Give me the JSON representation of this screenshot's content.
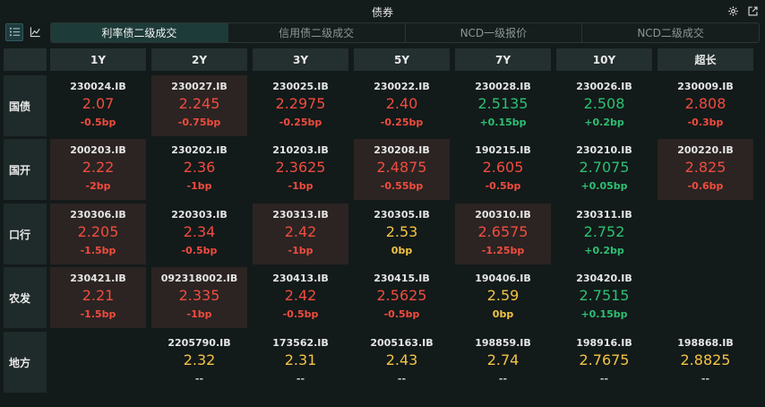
{
  "window": {
    "title": "债券"
  },
  "view_buttons": [
    {
      "name": "list-view-button",
      "icon": "list-icon",
      "active": true
    },
    {
      "name": "chart-view-button",
      "icon": "line-chart-icon",
      "active": false
    }
  ],
  "tabs": [
    {
      "label": "利率债二级成交",
      "active": true
    },
    {
      "label": "信用债二级成交",
      "active": false
    },
    {
      "label": "NCD一级报价",
      "active": false
    },
    {
      "label": "NCD二级成交",
      "active": false
    }
  ],
  "columns": [
    "1Y",
    "2Y",
    "3Y",
    "5Y",
    "7Y",
    "10Y",
    "超长"
  ],
  "rows": [
    {
      "label": "国债",
      "cells": [
        {
          "code": "230024.IB",
          "rate": "2.07",
          "change": "-0.5bp",
          "dir": "down",
          "hl": false
        },
        {
          "code": "230027.IB",
          "rate": "2.245",
          "change": "-0.75bp",
          "dir": "down",
          "hl": true
        },
        {
          "code": "230025.IB",
          "rate": "2.2975",
          "change": "-0.25bp",
          "dir": "down",
          "hl": false
        },
        {
          "code": "230022.IB",
          "rate": "2.40",
          "change": "-0.25bp",
          "dir": "down",
          "hl": false
        },
        {
          "code": "230028.IB",
          "rate": "2.5135",
          "change": "+0.15bp",
          "dir": "up",
          "hl": false
        },
        {
          "code": "230026.IB",
          "rate": "2.508",
          "change": "+0.2bp",
          "dir": "up",
          "hl": false
        },
        {
          "code": "230009.IB",
          "rate": "2.808",
          "change": "-0.3bp",
          "dir": "down",
          "hl": false
        }
      ]
    },
    {
      "label": "国开",
      "cells": [
        {
          "code": "200203.IB",
          "rate": "2.22",
          "change": "-2bp",
          "dir": "down",
          "hl": true
        },
        {
          "code": "230202.IB",
          "rate": "2.36",
          "change": "-1bp",
          "dir": "down",
          "hl": false
        },
        {
          "code": "210203.IB",
          "rate": "2.3625",
          "change": "-1bp",
          "dir": "down",
          "hl": false
        },
        {
          "code": "230208.IB",
          "rate": "2.4875",
          "change": "-0.55bp",
          "dir": "down",
          "hl": true
        },
        {
          "code": "190215.IB",
          "rate": "2.605",
          "change": "-0.5bp",
          "dir": "down",
          "hl": false
        },
        {
          "code": "230210.IB",
          "rate": "2.7075",
          "change": "+0.05bp",
          "dir": "up",
          "hl": false
        },
        {
          "code": "200220.IB",
          "rate": "2.825",
          "change": "-0.6bp",
          "dir": "down",
          "hl": true
        }
      ]
    },
    {
      "label": "口行",
      "cells": [
        {
          "code": "230306.IB",
          "rate": "2.205",
          "change": "-1.5bp",
          "dir": "down",
          "hl": true
        },
        {
          "code": "220303.IB",
          "rate": "2.34",
          "change": "-0.5bp",
          "dir": "down",
          "hl": false
        },
        {
          "code": "230313.IB",
          "rate": "2.42",
          "change": "-1bp",
          "dir": "down",
          "hl": true
        },
        {
          "code": "230305.IB",
          "rate": "2.53",
          "change": "0bp",
          "dir": "flat",
          "hl": false
        },
        {
          "code": "200310.IB",
          "rate": "2.6575",
          "change": "-1.25bp",
          "dir": "down",
          "hl": true
        },
        {
          "code": "230311.IB",
          "rate": "2.752",
          "change": "+0.2bp",
          "dir": "up",
          "hl": false
        },
        null
      ]
    },
    {
      "label": "农发",
      "cells": [
        {
          "code": "230421.IB",
          "rate": "2.21",
          "change": "-1.5bp",
          "dir": "down",
          "hl": true
        },
        {
          "code": "092318002.IB",
          "rate": "2.335",
          "change": "-1bp",
          "dir": "down",
          "hl": true
        },
        {
          "code": "230413.IB",
          "rate": "2.42",
          "change": "-0.5bp",
          "dir": "down",
          "hl": false
        },
        {
          "code": "230415.IB",
          "rate": "2.5625",
          "change": "-0.5bp",
          "dir": "down",
          "hl": false
        },
        {
          "code": "190406.IB",
          "rate": "2.59",
          "change": "0bp",
          "dir": "flat",
          "hl": false
        },
        {
          "code": "230420.IB",
          "rate": "2.7515",
          "change": "+0.15bp",
          "dir": "up",
          "hl": false
        },
        null
      ]
    },
    {
      "label": "地方",
      "cells": [
        null,
        {
          "code": "2205790.IB",
          "rate": "2.32",
          "change": "--",
          "dir": "none",
          "hl": false
        },
        {
          "code": "173562.IB",
          "rate": "2.31",
          "change": "--",
          "dir": "none",
          "hl": false
        },
        {
          "code": "2005163.IB",
          "rate": "2.43",
          "change": "--",
          "dir": "none",
          "hl": false
        },
        {
          "code": "198859.IB",
          "rate": "2.74",
          "change": "--",
          "dir": "none",
          "hl": false
        },
        {
          "code": "198916.IB",
          "rate": "2.7675",
          "change": "--",
          "dir": "none",
          "hl": false
        },
        {
          "code": "198868.IB",
          "rate": "2.8825",
          "change": "--",
          "dir": "none",
          "hl": false
        }
      ]
    }
  ],
  "colors": {
    "down": "#f04c3e",
    "up": "#2dbf72",
    "flat": "#f2c344",
    "highlight": "#2b2423",
    "accent": "#1d3b39"
  }
}
